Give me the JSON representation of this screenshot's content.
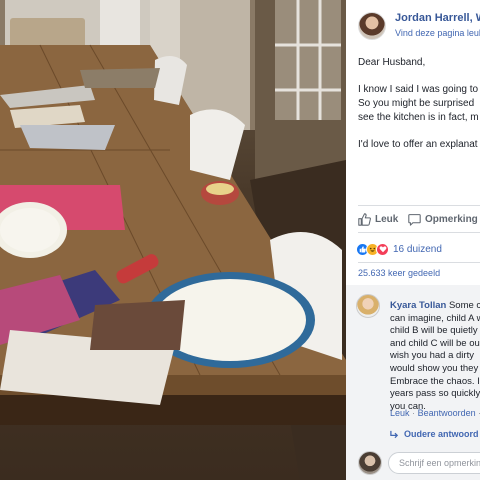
{
  "post": {
    "page_name": "Jordan Harrell, W",
    "page_like": "Vind deze pagina leuk",
    "letter": {
      "greeting": "Dear Husband,",
      "line1": "I know I said I was going to",
      "line2": "So you might be surprised",
      "line3": "see the kitchen is in fact, m",
      "line4": "I'd love to offer an explanat"
    },
    "actions": {
      "like": "Leuk",
      "comment": "Opmerking pl"
    },
    "reactions": {
      "count": "16 duizend",
      "icons": [
        "like-icon",
        "haha-icon",
        "love-icon"
      ]
    },
    "shares": "25.633 keer gedeeld"
  },
  "comment": {
    "author": "Kyara Tollan",
    "first_line_rest": "Some c",
    "lines": [
      "can imagine, child A w",
      "child B will be quietly",
      "and child C will be ou",
      "wish you had a dirty",
      "would show you they",
      "Embrace the chaos. I",
      "years pass so quickly",
      "you can."
    ],
    "like_label": "Leuk",
    "separator": "·",
    "reply_label": "Beantwoorden",
    "dash": "·",
    "older_replies": "Oudere antwoord"
  },
  "compose": {
    "placeholder": "Schrijf een opmerking"
  },
  "colors": {
    "link": "#385898",
    "accent": "#4267b2",
    "text": "#1d2129",
    "muted": "#606770",
    "comment_bg": "#f2f3f5"
  }
}
